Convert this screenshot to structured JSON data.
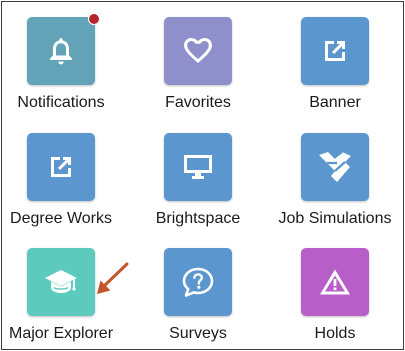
{
  "tiles": [
    {
      "label": "Notifications",
      "icon": "bell-icon",
      "color": "#62a3b8"
    },
    {
      "label": "Favorites",
      "icon": "heart-icon",
      "color": "#8f8fcc"
    },
    {
      "label": "Banner",
      "icon": "open-external-icon",
      "color": "#5b96cf"
    },
    {
      "label": "Degree Works",
      "icon": "open-external-icon",
      "color": "#5b96cf"
    },
    {
      "label": "Brightspace",
      "icon": "monitor-icon",
      "color": "#5b96cf"
    },
    {
      "label": "Job Simulations",
      "icon": "school-logo-icon",
      "color": "#5b96cf"
    },
    {
      "label": "Major Explorer",
      "icon": "graduation-cap-icon",
      "color": "#5ccbbe"
    },
    {
      "label": "Surveys",
      "icon": "question-speech-bubble-icon",
      "color": "#5b96cf"
    },
    {
      "label": "Holds",
      "icon": "warning-triangle-icon",
      "color": "#b85ec9"
    }
  ],
  "colors": {
    "notification_badge": "#b3262b",
    "arrow": "#c2562a",
    "label_text": "#1a1a1a",
    "frame_border": "#3d3d3d"
  }
}
